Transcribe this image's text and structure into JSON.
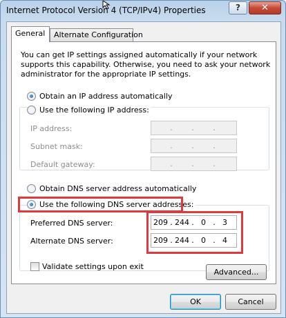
{
  "window": {
    "title": "Internet Protocol Version 4 (TCP/IPv4) Properties",
    "help_label": "?",
    "close_label": "✕"
  },
  "tabs": [
    {
      "label": "General",
      "active": true
    },
    {
      "label": "Alternate Configuration",
      "active": false
    }
  ],
  "general": {
    "intro": "You can get IP settings assigned automatically if your network supports this capability. Otherwise, you need to ask your network administrator for the appropriate IP settings.",
    "ip_mode": {
      "auto_label": "Obtain an IP address automatically",
      "manual_label": "Use the following IP address:",
      "selected": "auto"
    },
    "ip_fields": [
      {
        "label": "IP address:",
        "value": [
          "",
          "",
          "",
          ""
        ],
        "enabled": false
      },
      {
        "label": "Subnet mask:",
        "value": [
          "",
          "",
          "",
          ""
        ],
        "enabled": false
      },
      {
        "label": "Default gateway:",
        "value": [
          "",
          "",
          "",
          ""
        ],
        "enabled": false
      }
    ],
    "dns_mode": {
      "auto_label": "Obtain DNS server address automatically",
      "manual_label": "Use the following DNS server addresses:",
      "selected": "manual"
    },
    "dns_fields": [
      {
        "label": "Preferred DNS server:",
        "value": [
          "209",
          "244",
          "0",
          "3"
        ],
        "enabled": true
      },
      {
        "label": "Alternate DNS server:",
        "value": [
          "209",
          "244",
          "0",
          "4"
        ],
        "enabled": true
      }
    ],
    "validate_label": "Validate settings upon exit",
    "validate_checked": false,
    "advanced_label": "Advanced..."
  },
  "footer": {
    "ok_label": "OK",
    "cancel_label": "Cancel"
  },
  "colors": {
    "highlight": "#e0393d",
    "title_gradient": "#b9d1ea",
    "close_button": "#c74a37"
  }
}
